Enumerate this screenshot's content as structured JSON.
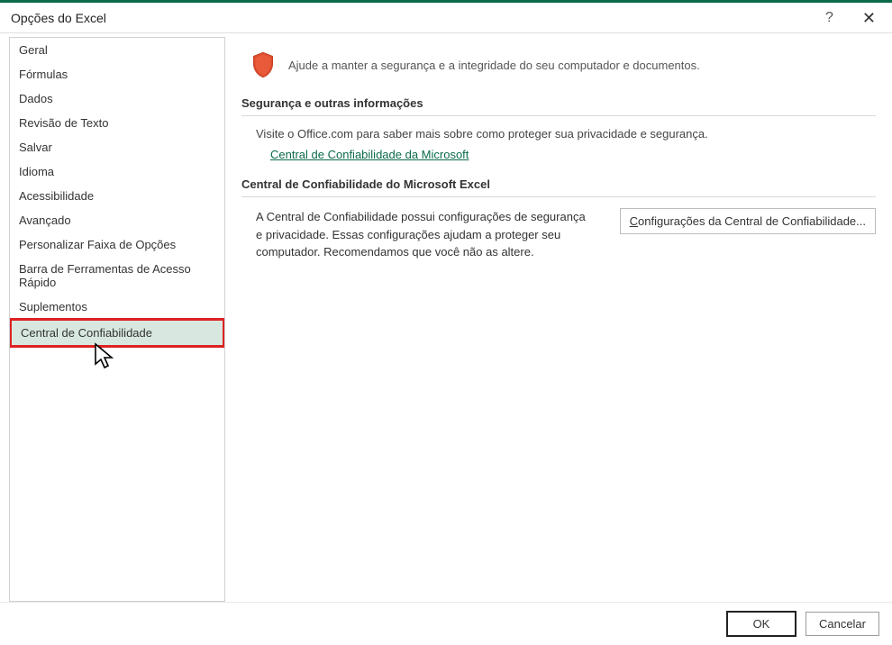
{
  "titlebar": {
    "title": "Opções do Excel"
  },
  "sidebar": {
    "items": [
      {
        "label": "Geral"
      },
      {
        "label": "Fórmulas"
      },
      {
        "label": "Dados"
      },
      {
        "label": "Revisão de Texto"
      },
      {
        "label": "Salvar"
      },
      {
        "label": "Idioma"
      },
      {
        "label": "Acessibilidade"
      },
      {
        "label": "Avançado"
      },
      {
        "label": "Personalizar Faixa de Opções"
      },
      {
        "label": "Barra de Ferramentas de Acesso Rápido"
      },
      {
        "label": "Suplementos"
      },
      {
        "label": "Central de Confiabilidade"
      }
    ]
  },
  "content": {
    "banner_text": "Ajude a manter a segurança e a integridade do seu computador e documentos.",
    "section1_title": "Segurança e outras informações",
    "section1_info": "Visite o Office.com para saber mais sobre como proteger sua privacidade e segurança.",
    "section1_link": "Central de Confiabilidade da Microsoft",
    "section2_title": "Central de Confiabilidade do Microsoft Excel",
    "section2_desc": "A Central de Confiabilidade possui configurações de segurança e privacidade. Essas configurações ajudam a proteger seu computador. Recomendamos que você não as altere.",
    "section2_button_prefix": "C",
    "section2_button_rest": "onfigurações da Central de Confiabilidade..."
  },
  "footer": {
    "ok": "OK",
    "cancel": "Cancelar"
  }
}
